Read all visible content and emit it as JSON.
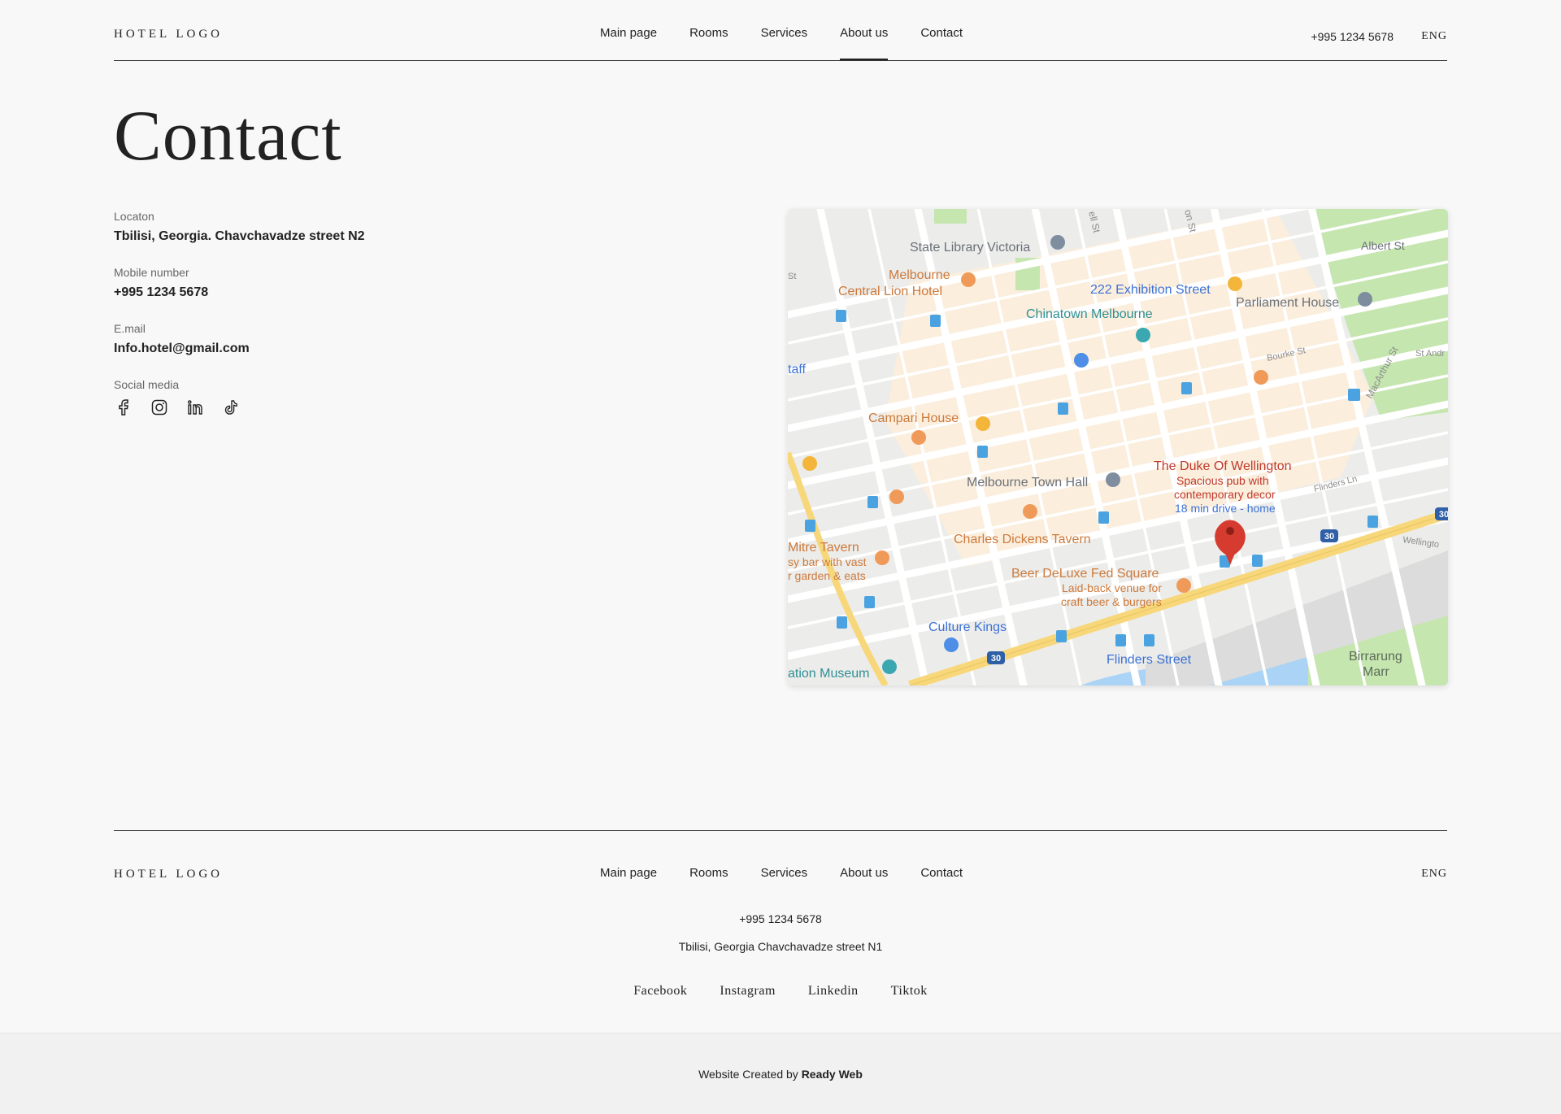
{
  "header": {
    "logo": "HOTEL LOGO",
    "nav": [
      {
        "label": "Main page"
      },
      {
        "label": "Rooms"
      },
      {
        "label": "Services"
      },
      {
        "label": "About us"
      },
      {
        "label": "Contact"
      }
    ],
    "active_nav": "About us",
    "phone": "+995 1234 5678",
    "lang": "ENG"
  },
  "page": {
    "title": "Contact",
    "location_label": "Locaton",
    "location_value": "Tbilisi, Georgia. Chavchavadze street N2",
    "mobile_label": "Mobile number",
    "mobile_value": "+995 1234 5678",
    "email_label": "E.mail",
    "email_value": "Info.hotel@gmail.com",
    "social_label": "Social media",
    "social_icons": [
      "facebook-icon",
      "instagram-icon",
      "linkedin-icon",
      "tiktok-icon"
    ]
  },
  "map": {
    "labels": {
      "state_library": "State Library Victoria",
      "melbourne": "Melbourne",
      "central_lion": "Central Lion Hotel",
      "exhibition": "222 Exhibition Street",
      "parliament": "Parliament House",
      "chinatown": "Chinatown Melbourne",
      "campari": "Campari House",
      "duke": "The Duke Of Wellington",
      "duke_desc1": "Spacious pub with",
      "duke_desc2": "contemporary decor",
      "duke_drive": "18 min drive - home",
      "town_hall": "Melbourne Town Hall",
      "charles": "Charles Dickens Tavern",
      "mitre": "Mitre Tavern",
      "mitre_desc1": "sy bar with vast",
      "mitre_desc2": "r garden & eats",
      "beer": "Beer DeLuxe Fed Square",
      "beer_desc1": "Laid-back venue for",
      "beer_desc2": "craft beer & burgers",
      "culture": "Culture Kings",
      "flinders": "Flinders Street",
      "birrarung1": "Birrarung",
      "birrarung2": "Marr",
      "museum": "ation Museum",
      "albert": "Albert St",
      "bourke": "Bourke St",
      "macarthur": "MacArthur St",
      "st_and": "St Andr",
      "flinders_ln": "Flinders Ln",
      "wellington": "Wellingto",
      "staff": "taff",
      "st_left": "St",
      "ell_st": "ell St",
      "on_st": "on St",
      "route": "30"
    },
    "colors": {
      "road": "#ffffff",
      "block": "#e9e9e7",
      "cbd": "#fbeedd",
      "park": "#c6e6b0",
      "water": "#aad3f5",
      "freeway": "#f7d77a",
      "pin": "#d63b2f"
    }
  },
  "footer": {
    "logo": "HOTEL LOGO",
    "phone": "+995 1234 5678",
    "address": "Tbilisi, Georgia Chavchavadze street N1",
    "socials": [
      {
        "label": "Facebook"
      },
      {
        "label": "Instagram"
      },
      {
        "label": "Linkedin"
      },
      {
        "label": "Tiktok"
      }
    ],
    "lang": "ENG",
    "credit_prefix": "Website Created by",
    "credit_brand": "Ready Web"
  }
}
